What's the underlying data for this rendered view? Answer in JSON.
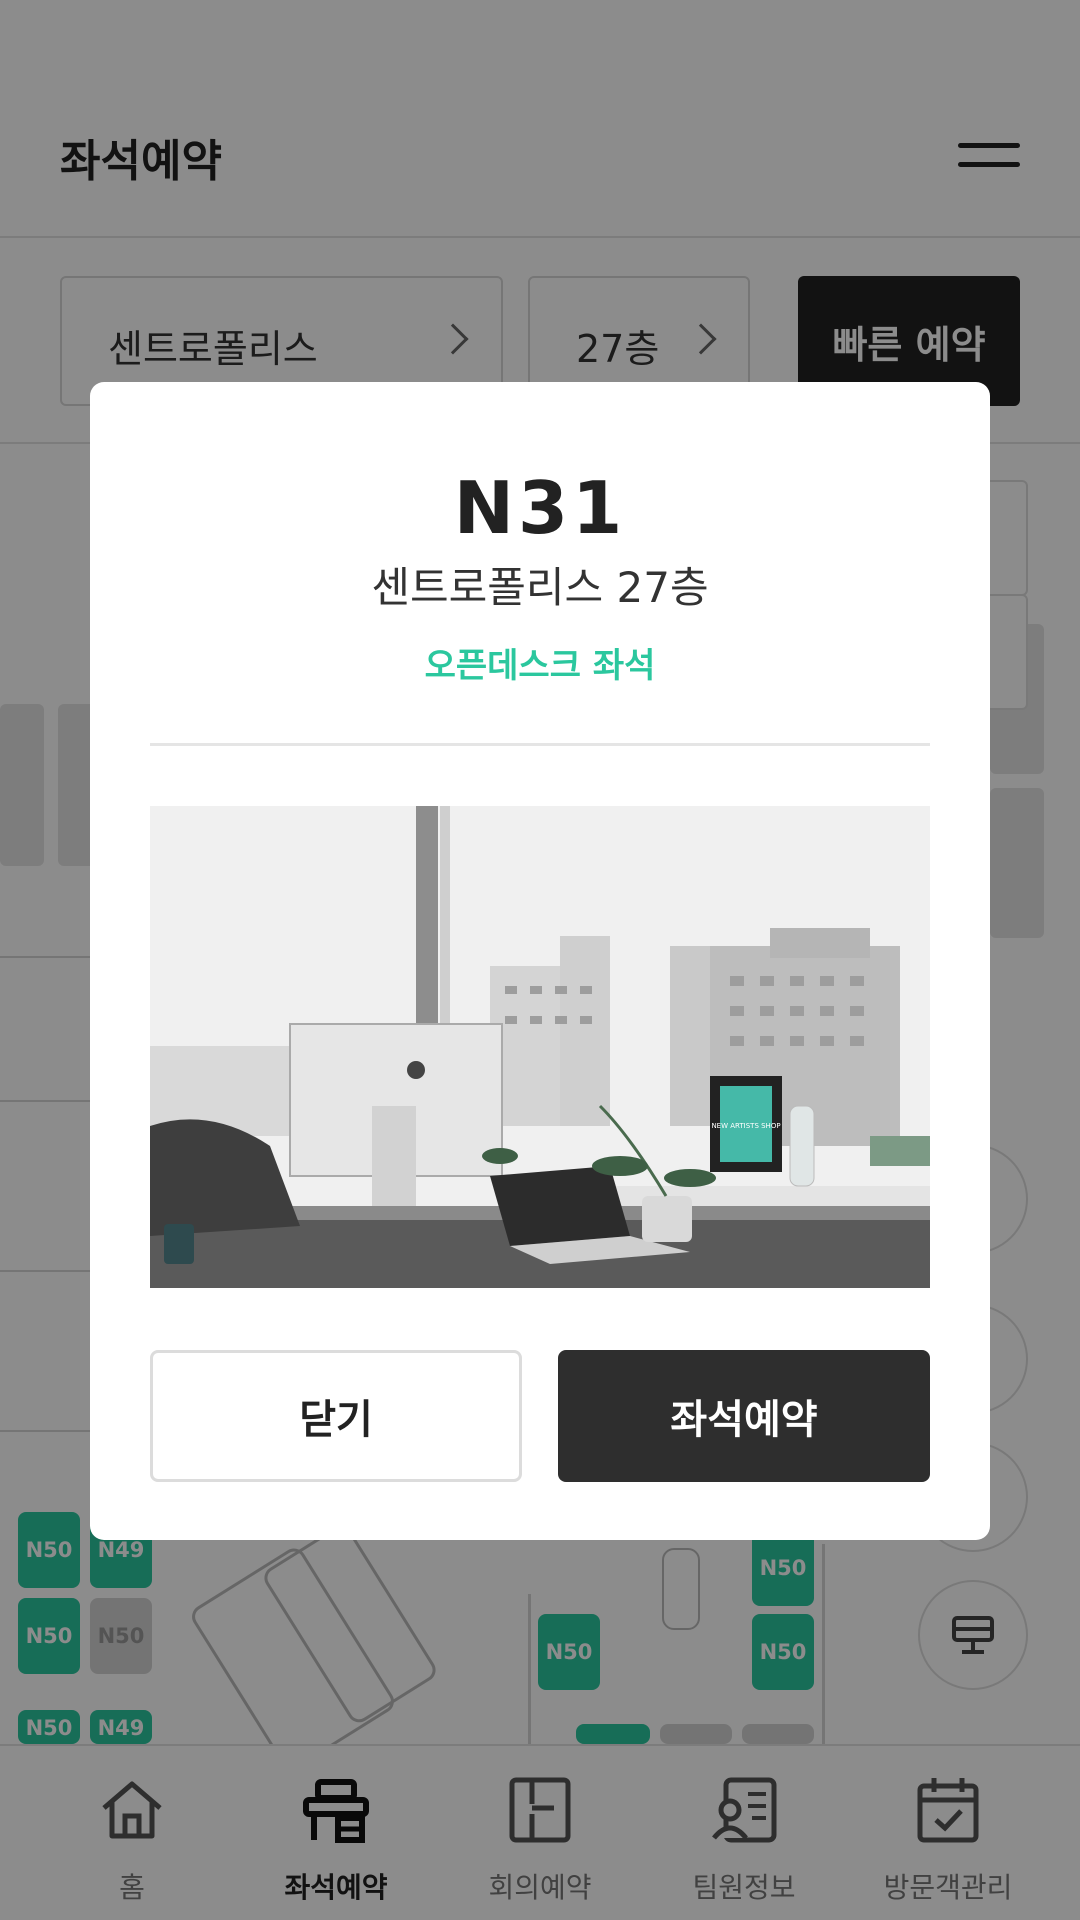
{
  "header": {
    "title": "좌석예약",
    "menu_icon": "hamburger-icon"
  },
  "filters": {
    "building": "센트로폴리스",
    "floor": "27층",
    "quick_reserve": "빠른 예약"
  },
  "map": {
    "seats": [
      {
        "label": "N50",
        "state": "available"
      },
      {
        "label": "N49",
        "state": "available"
      },
      {
        "label": "N50",
        "state": "available"
      },
      {
        "label": "N50",
        "state": "occupied"
      },
      {
        "label": "N50",
        "state": "available"
      },
      {
        "label": "N50",
        "state": "available"
      },
      {
        "label": "N50",
        "state": "available"
      },
      {
        "label": "N50",
        "state": "available"
      },
      {
        "label": "N49",
        "state": "available"
      }
    ]
  },
  "modal": {
    "seat_id": "N31",
    "location": "센트로폴리스 27층",
    "seat_type": "오픈데스크 좌석",
    "close_label": "닫기",
    "reserve_label": "좌석예약",
    "photo_poster_text": "NEW ARTISTS SHOP"
  },
  "tabbar": {
    "items": [
      {
        "label": "홈",
        "icon": "home-icon",
        "active": false
      },
      {
        "label": "좌석예약",
        "icon": "desk-icon",
        "active": true
      },
      {
        "label": "회의예약",
        "icon": "meeting-room-icon",
        "active": false
      },
      {
        "label": "팀원정보",
        "icon": "contact-card-icon",
        "active": false
      },
      {
        "label": "방문객관리",
        "icon": "calendar-check-icon",
        "active": false
      }
    ]
  },
  "colors": {
    "accent": "#2bc79e",
    "dark": "#2e2e2e",
    "overlay": "rgba(0,0,0,0.45)"
  }
}
